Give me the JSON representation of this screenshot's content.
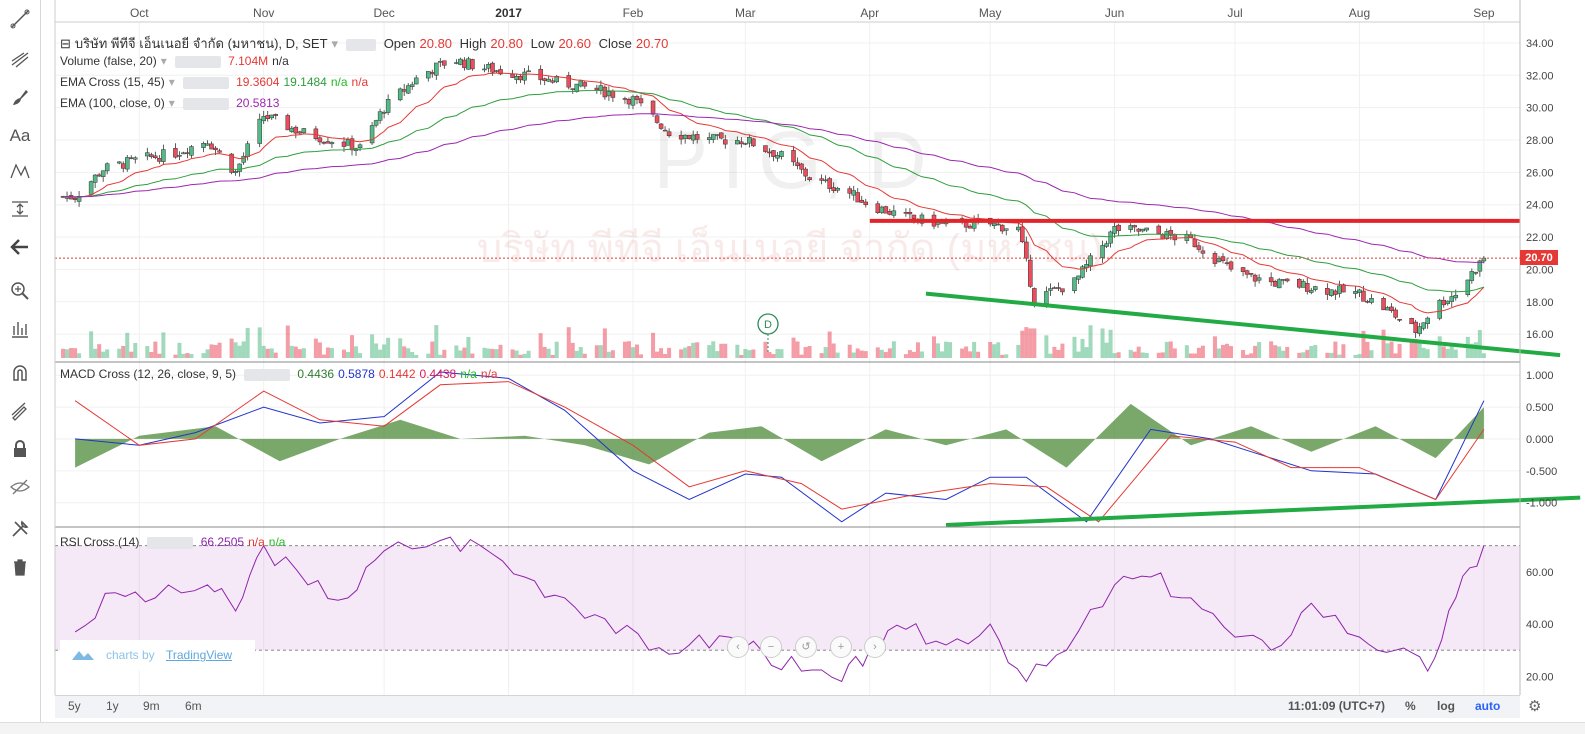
{
  "symbol_title": "บริษัท พีทีจี เอ็นเนอยี จำกัด (มหาชน), D, SET",
  "watermark_symbol": "PTG, D",
  "watermark_name": "บริษัท พีทีจี เอ็นเนอยี จำกัด (มหาชน)",
  "ohlc": {
    "open_label": "Open",
    "open": "20.80",
    "high_label": "High",
    "high": "20.80",
    "low_label": "Low",
    "low": "20.60",
    "close_label": "Close",
    "close": "20.70"
  },
  "legend": {
    "volume": {
      "label": "Volume (false, 20)",
      "v1": "7.104M",
      "v2": "n/a"
    },
    "ema_cross": {
      "label": "EMA Cross (15, 45)",
      "v1": "19.3604",
      "v2": "19.1484",
      "v3": "n/a",
      "v4": "n/a"
    },
    "ema100": {
      "label": "EMA (100, close, 0)",
      "v1": "20.5813"
    },
    "macd": {
      "label": "MACD Cross (12, 26, close, 9, 5)",
      "v1": "0.4436",
      "v2": "0.5878",
      "v3": "0.1442",
      "v4": "0.4438",
      "v5": "n/a",
      "v6": "n/a"
    },
    "rsi": {
      "label": "RSI Cross (14)",
      "v1": "66.2505",
      "v2": "n/a",
      "v3": "n/a"
    }
  },
  "price_label": "20.70",
  "dividend_marker": "D",
  "branding": {
    "prefix": "charts by",
    "name": "TradingView"
  },
  "bottom_bar": {
    "ranges": [
      "5y",
      "1y",
      "9m",
      "6m"
    ],
    "time": "11:01:09 (UTC+7)",
    "pct": "%",
    "log": "log",
    "auto": "auto"
  },
  "colors": {
    "up": "#53b987",
    "down": "#eb4d5c",
    "ema15": "#e53935",
    "ema45": "#2e9e3d",
    "ema100": "#9c27b0",
    "macd": "#2233cc",
    "signal": "#e53935",
    "hist": "#4e8b3a",
    "rsi": "#8e24aa",
    "resistance": "#e3242b",
    "trendline": "#22aa44"
  },
  "chart_data": [
    {
      "type": "candlestick",
      "title": "บริษัท พีทีจี เอ็นเนอยี จำกัด (มหาชน), D, SET",
      "x_ticks": [
        "Oct",
        "Nov",
        "Dec",
        "2017",
        "Feb",
        "Mar",
        "Apr",
        "May",
        "Jun",
        "Jul",
        "Aug",
        "Sep"
      ],
      "y_ticks": [
        "16.00",
        "18.00",
        "20.00",
        "22.00",
        "24.00",
        "26.00",
        "28.00",
        "30.00",
        "32.00",
        "34.00"
      ],
      "ylim": [
        14.4,
        34.8
      ],
      "close_path": [
        [
          "2016-09-15",
          24.5
        ],
        [
          "2016-09-22",
          26.2
        ],
        [
          "2016-10-01",
          26.8
        ],
        [
          "2016-10-10",
          27.2
        ],
        [
          "2016-10-18",
          28.0
        ],
        [
          "2016-10-25",
          26.0
        ],
        [
          "2016-11-01",
          29.5
        ],
        [
          "2016-11-10",
          28.5
        ],
        [
          "2016-11-18",
          28.0
        ],
        [
          "2016-11-25",
          27.5
        ],
        [
          "2016-12-01",
          30.0
        ],
        [
          "2016-12-10",
          32.0
        ],
        [
          "2016-12-18",
          33.0
        ],
        [
          "2016-12-25",
          32.5
        ],
        [
          "2017-01-05",
          32.0
        ],
        [
          "2017-01-15",
          31.5
        ],
        [
          "2017-01-25",
          31.0
        ],
        [
          "2017-02-01",
          30.5
        ],
        [
          "2017-02-10",
          28.5
        ],
        [
          "2017-02-20",
          28.0
        ],
        [
          "2017-03-01",
          28.0
        ],
        [
          "2017-03-10",
          27.0
        ],
        [
          "2017-03-18",
          25.5
        ],
        [
          "2017-03-25",
          25.0
        ],
        [
          "2017-04-01",
          24.0
        ],
        [
          "2017-04-10",
          23.2
        ],
        [
          "2017-04-20",
          22.8
        ],
        [
          "2017-05-01",
          22.8
        ],
        [
          "2017-05-08",
          22.5
        ],
        [
          "2017-05-12",
          18.2
        ],
        [
          "2017-05-22",
          19.2
        ],
        [
          "2017-06-01",
          22.5
        ],
        [
          "2017-06-10",
          22.3
        ],
        [
          "2017-06-20",
          21.8
        ],
        [
          "2017-07-01",
          19.8
        ],
        [
          "2017-07-10",
          19.2
        ],
        [
          "2017-07-18",
          19.0
        ],
        [
          "2017-07-25",
          18.7
        ],
        [
          "2017-08-01",
          18.5
        ],
        [
          "2017-08-08",
          17.5
        ],
        [
          "2017-08-15",
          16.2
        ],
        [
          "2017-08-20",
          17.8
        ],
        [
          "2017-08-25",
          18.5
        ],
        [
          "2017-09-01",
          20.7
        ]
      ],
      "volume_note": "Volume (false, 20)",
      "resistance_level": 23.0,
      "trendline": [
        [
          "2017-04-15",
          18.5
        ],
        [
          "2017-09-20",
          14.7
        ]
      ],
      "last_close": 20.7
    },
    {
      "type": "line",
      "title": "MACD Cross (12, 26, close, 9, 5)",
      "y_ticks": [
        "-1.000",
        "-0.500",
        "0.000",
        "0.500",
        "1.000"
      ],
      "ylim": [
        -1.35,
        1.05
      ],
      "series": [
        {
          "name": "MACD",
          "values": [
            [
              "2016-09-15",
              0.0
            ],
            [
              "2016-10-01",
              -0.1
            ],
            [
              "2016-10-15",
              0.1
            ],
            [
              "2016-11-01",
              0.5
            ],
            [
              "2016-11-15",
              0.25
            ],
            [
              "2016-12-01",
              0.35
            ],
            [
              "2016-12-15",
              1.05
            ],
            [
              "2017-01-01",
              0.95
            ],
            [
              "2017-01-15",
              0.45
            ],
            [
              "2017-02-01",
              -0.5
            ],
            [
              "2017-02-15",
              -0.95
            ],
            [
              "2017-03-01",
              -0.55
            ],
            [
              "2017-03-10",
              -0.6
            ],
            [
              "2017-03-25",
              -1.3
            ],
            [
              "2017-04-05",
              -0.85
            ],
            [
              "2017-04-20",
              -0.95
            ],
            [
              "2017-05-01",
              -0.6
            ],
            [
              "2017-05-10",
              -0.6
            ],
            [
              "2017-05-25",
              -1.3
            ],
            [
              "2017-06-10",
              0.15
            ],
            [
              "2017-06-25",
              0.0
            ],
            [
              "2017-07-05",
              -0.2
            ],
            [
              "2017-07-20",
              -0.5
            ],
            [
              "2017-08-05",
              -0.55
            ],
            [
              "2017-08-20",
              -0.95
            ],
            [
              "2017-09-01",
              0.6
            ]
          ]
        },
        {
          "name": "Signal",
          "values": [
            [
              "2016-09-15",
              0.6
            ],
            [
              "2016-10-01",
              -0.1
            ],
            [
              "2016-10-15",
              0.0
            ],
            [
              "2016-11-01",
              0.75
            ],
            [
              "2016-11-15",
              0.3
            ],
            [
              "2016-12-01",
              0.2
            ],
            [
              "2016-12-15",
              0.85
            ],
            [
              "2017-01-01",
              0.9
            ],
            [
              "2017-01-15",
              0.5
            ],
            [
              "2017-02-01",
              -0.1
            ],
            [
              "2017-02-15",
              -0.75
            ],
            [
              "2017-03-01",
              -0.5
            ],
            [
              "2017-03-15",
              -0.7
            ],
            [
              "2017-03-25",
              -1.1
            ],
            [
              "2017-04-10",
              -0.9
            ],
            [
              "2017-05-01",
              -0.7
            ],
            [
              "2017-05-15",
              -0.75
            ],
            [
              "2017-05-28",
              -1.3
            ],
            [
              "2017-06-15",
              0.05
            ],
            [
              "2017-07-01",
              -0.05
            ],
            [
              "2017-07-15",
              -0.45
            ],
            [
              "2017-08-01",
              -0.45
            ],
            [
              "2017-08-20",
              -0.95
            ],
            [
              "2017-09-01",
              0.15
            ]
          ]
        },
        {
          "name": "Histogram",
          "values": [
            [
              "2016-09-15",
              -0.45
            ],
            [
              "2016-10-01",
              0.05
            ],
            [
              "2016-10-20",
              0.2
            ],
            [
              "2016-11-05",
              -0.35
            ],
            [
              "2016-11-20",
              0.0
            ],
            [
              "2016-12-05",
              0.3
            ],
            [
              "2016-12-20",
              0.0
            ],
            [
              "2017-01-05",
              0.05
            ],
            [
              "2017-01-20",
              -0.1
            ],
            [
              "2017-02-05",
              -0.4
            ],
            [
              "2017-02-20",
              0.1
            ],
            [
              "2017-03-05",
              0.2
            ],
            [
              "2017-03-20",
              -0.35
            ],
            [
              "2017-04-05",
              0.15
            ],
            [
              "2017-04-20",
              -0.1
            ],
            [
              "2017-05-05",
              0.15
            ],
            [
              "2017-05-20",
              -0.45
            ],
            [
              "2017-06-05",
              0.55
            ],
            [
              "2017-06-20",
              -0.1
            ],
            [
              "2017-07-05",
              0.2
            ],
            [
              "2017-07-20",
              -0.2
            ],
            [
              "2017-08-05",
              0.2
            ],
            [
              "2017-08-20",
              -0.3
            ],
            [
              "2017-09-01",
              0.5
            ]
          ]
        }
      ],
      "trendline": [
        [
          "2017-04-20",
          -1.35
        ],
        [
          "2017-09-25",
          -0.92
        ]
      ]
    },
    {
      "type": "line",
      "title": "RSI Cross (14)",
      "y_ticks": [
        "20.00",
        "40.00",
        "60.00"
      ],
      "ylim": [
        14.0,
        76.0
      ],
      "bands": [
        30,
        70
      ],
      "series": [
        {
          "name": "RSI",
          "values": [
            [
              "2016-09-15",
              37.0
            ],
            [
              "2016-09-25",
              52.0
            ],
            [
              "2016-10-05",
              50.0
            ],
            [
              "2016-10-18",
              55.0
            ],
            [
              "2016-10-25",
              45.0
            ],
            [
              "2016-11-01",
              70.0
            ],
            [
              "2016-11-12",
              55.0
            ],
            [
              "2016-11-22",
              50.0
            ],
            [
              "2016-12-01",
              68.0
            ],
            [
              "2016-12-15",
              72.0
            ],
            [
              "2016-12-25",
              70.0
            ],
            [
              "2017-01-05",
              58.0
            ],
            [
              "2017-01-15",
              50.0
            ],
            [
              "2017-01-25",
              42.0
            ],
            [
              "2017-02-05",
              30.0
            ],
            [
              "2017-02-15",
              32.0
            ],
            [
              "2017-02-25",
              35.0
            ],
            [
              "2017-03-05",
              30.0
            ],
            [
              "2017-03-15",
              22.0
            ],
            [
              "2017-03-25",
              18.0
            ],
            [
              "2017-04-01",
              30.0
            ],
            [
              "2017-04-10",
              38.0
            ],
            [
              "2017-04-20",
              32.0
            ],
            [
              "2017-05-01",
              40.0
            ],
            [
              "2017-05-10",
              18.0
            ],
            [
              "2017-05-20",
              30.0
            ],
            [
              "2017-06-01",
              55.0
            ],
            [
              "2017-06-10",
              58.0
            ],
            [
              "2017-06-20",
              50.0
            ],
            [
              "2017-07-01",
              35.0
            ],
            [
              "2017-07-10",
              30.0
            ],
            [
              "2017-07-20",
              48.0
            ],
            [
              "2017-08-01",
              35.0
            ],
            [
              "2017-08-10",
              30.0
            ],
            [
              "2017-08-18",
              22.0
            ],
            [
              "2017-08-25",
              50.0
            ],
            [
              "2017-09-01",
              70.0
            ]
          ]
        }
      ]
    }
  ]
}
